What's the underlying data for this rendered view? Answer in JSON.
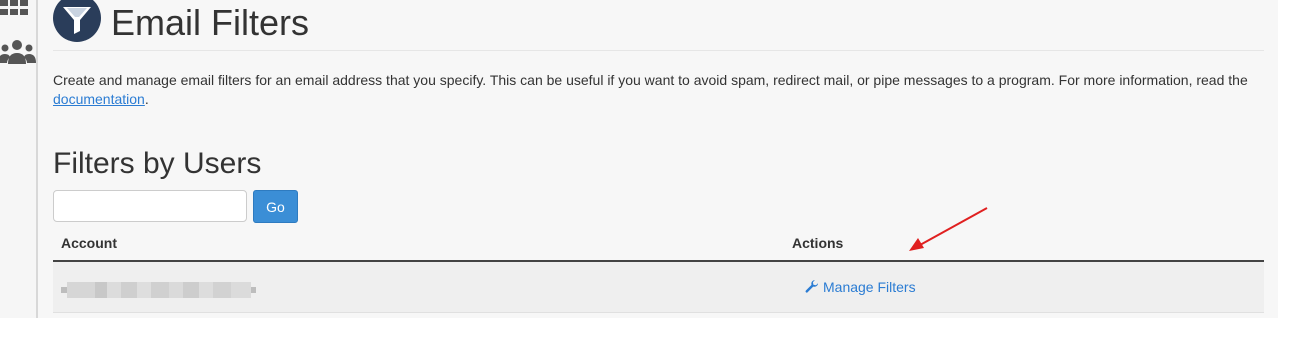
{
  "header": {
    "title": "Email Filters"
  },
  "description": {
    "text_before_link": "Create and manage email filters for an email address that you specify. This can be useful if you want to avoid spam, redirect mail, or pipe messages to a program. For more information, read the ",
    "link_text": "documentation",
    "text_after_link": "."
  },
  "filters_section": {
    "title": "Filters by Users",
    "search_value": "",
    "go_label": "Go",
    "columns": [
      "Account",
      "Actions"
    ],
    "rows": [
      {
        "account": "",
        "action_label": "Manage Filters"
      }
    ]
  },
  "sidebar": {
    "icons": [
      "grid-icon",
      "users-icon"
    ]
  },
  "icons": {
    "page": "funnel-icon",
    "action": "wrench-icon"
  },
  "colors": {
    "link": "#2b7cd3",
    "primary_button": "#3b8ed6",
    "title_icon_bg": "#2a3d5a",
    "annotation_arrow": "#e02020"
  }
}
